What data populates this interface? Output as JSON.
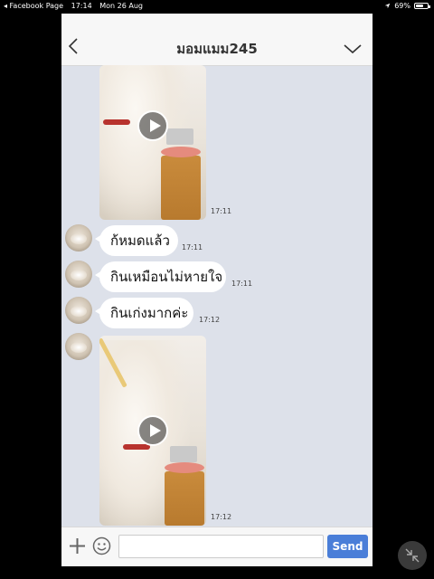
{
  "status_bar": {
    "back_app": "◂ Facebook Page",
    "time": "17:14",
    "date": "Mon 26 Aug",
    "battery": "69%",
    "battery_level": 0.69
  },
  "chat": {
    "title": "มอมแมม245",
    "messages": [
      {
        "type": "video",
        "time": "17:11"
      },
      {
        "type": "text",
        "text": "ก้หมดแล้ว",
        "time": "17:11"
      },
      {
        "type": "text",
        "text": "กินเหมือนไม่หายใจ",
        "time": "17:11"
      },
      {
        "type": "text",
        "text": "กินเก่งมากค่ะ",
        "time": "17:12"
      },
      {
        "type": "video",
        "time": "17:12"
      }
    ]
  },
  "input_bar": {
    "message_value": "",
    "message_placeholder": "",
    "send_label": "Send"
  },
  "icons": {
    "back": "chevron-left-icon",
    "collapse": "chevron-down-icon",
    "add": "plus-icon",
    "emoji": "smiley-icon",
    "play": "play-icon",
    "exit_fullscreen": "shrink-arrows-icon"
  },
  "colors": {
    "chat_background": "#dde1ea",
    "send_button": "#4a7ed8",
    "header_background": "#f7f7f7"
  }
}
